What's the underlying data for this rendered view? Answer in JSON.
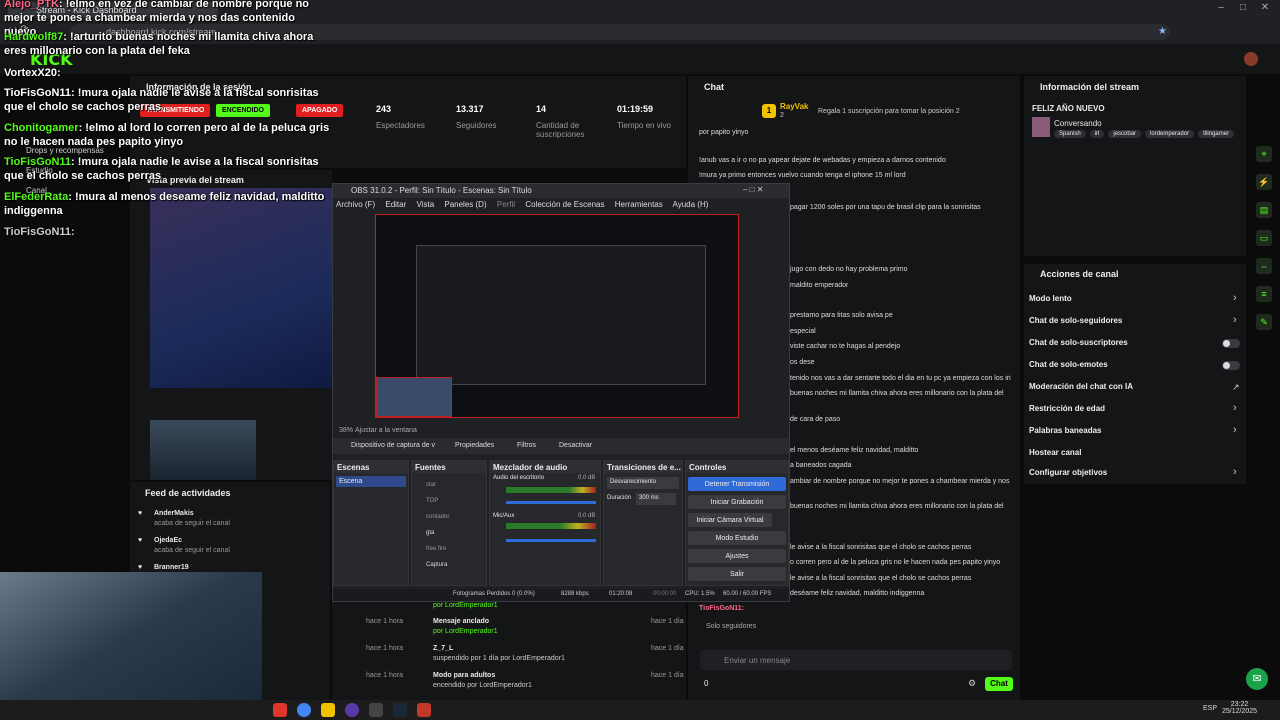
{
  "browser": {
    "tab_title": "Stream - Kick Dashboard",
    "url": "dashboard.kick.com/stream"
  },
  "kick": {
    "logo": "KICK"
  },
  "session": {
    "title": "Información de la sesión",
    "badges": [
      "TRANSMITIENDO",
      "ENCENDIDO",
      "APAGADO"
    ],
    "stats": [
      {
        "value": "243",
        "label": "Espectadores"
      },
      {
        "value": "13.317",
        "label": "Seguidores"
      },
      {
        "value": "14",
        "label": "Cantidad de suscripciones"
      },
      {
        "value": "01:19:59",
        "label": "Tiempo en vivo"
      }
    ],
    "left_menu": [
      "Drops y recompensas",
      "Canal",
      "Estudio"
    ],
    "preview_title": "Vista previa del stream"
  },
  "overlay_chat": [
    {
      "user": "Alejo_PTK",
      "msg": "!elmo en vez de cambiar de nombre porque no mejor te pones a chambear mierda y nos das contenido nuevo"
    },
    {
      "user": "Hardwolf87",
      "msg": "!arturito buenas noches mi llamita chiva ahora eres millonario con la plata del feka"
    },
    {
      "user": "VortexX20",
      "msg": ""
    },
    {
      "user": "TioFisGoN11",
      "msg": "!mura ojala nadie le avise a la fiscal sonrisitas que el cholo se cachos perras"
    },
    {
      "user": "Chonitogamer",
      "msg": "!elmo al lord lo corren pero al de la peluca gris no le hacen nada pes papito yinyo"
    },
    {
      "user": "TioFisGoN11",
      "msg": "!mura ojala nadie le avise a la fiscal sonrisitas que el cholo se cachos perras"
    },
    {
      "user": "ElFederRata",
      "msg": "!mura al menos deseame feliz navidad, malditto indiggenna"
    },
    {
      "user": "TioFisGoN11",
      "msg": ""
    }
  ],
  "obs": {
    "title": "OBS 31.0.2 - Perfil: Sin Título - Escenas: Sin Título",
    "menu": [
      "Archivo (F)",
      "Editar",
      "Vista",
      "Paneles (D)",
      "Perfil",
      "Colección de Escenas",
      "Herramientas",
      "Ayuda (H)"
    ],
    "zoom": "38%",
    "fit_label": "Ajustar a la ventana",
    "source_bar": {
      "source": "Dispositivo de captura de v",
      "props": "Propiedades",
      "filters": "Filtros",
      "deactivate": "Desactivar"
    },
    "docks": {
      "scenes": {
        "title": "Escenas",
        "items": [
          "Escena"
        ]
      },
      "sources": {
        "title": "Fuentes",
        "items": [
          "star",
          "TOP",
          "contador",
          "gta",
          "free fire",
          "Captura"
        ]
      },
      "mixer": {
        "title": "Mezclador de audio",
        "channels": [
          {
            "name": "Audio del escritorio",
            "db": "0.0 dB"
          },
          {
            "name": "Mic/Aux",
            "db": "0.0 dB"
          }
        ]
      },
      "transitions": {
        "title": "Transiciones de e...",
        "type": "Desvanecimiento",
        "duration_label": "Duración",
        "duration": "300 ms"
      },
      "controls": {
        "title": "Controles",
        "buttons": [
          "Detener Transmisión",
          "Iniciar Grabación",
          "Iniciar Cámara Virtual",
          "Modo Estudio",
          "Ajustes",
          "Salir"
        ]
      }
    },
    "status": {
      "dropped": "Fotogramas Perdidos 0 (0.0%)",
      "bitrate": "8288 kbps",
      "live": "01:20:08",
      "rec": "00:00:00",
      "cpu": "CPU: 1.5%",
      "fps": "60.00 / 60.00 FPS"
    }
  },
  "chat": {
    "title": "Chat",
    "top_user": "RayVak",
    "top_rank": "1",
    "top_count": "2",
    "sub_prompt": "Regala 1 suscripción para tomar la posición 2",
    "lines": [
      "por papito yinyo",
      "!anub vas a ir o no pa yapear dejate de webadas y empieza a darnos contenido",
      "!mura ya primo entonces vuelvo cuando tenga el iphone 15 ml lord",
      "pagar 1200 soles por una tapu de brasil clip para la sonrisitas",
      "jugo con dedo no hay problema primo",
      "maldito emperador",
      "prestamo para titas solo avisa pe",
      "especial",
      "viste cachar no te hagas al pendejo",
      "os dese",
      "tenido nos vas a dar sentarte todo el dia en tu pc ya empieza con los iri",
      "buenas noches mi llamita chiva ahora eres millonario con la plata del",
      "de cara de paso",
      "el menos deséame feliz navidad, malditto",
      "a baneados cagada",
      "ambiar de nombre porque no mejor te pones a chambear mierda y nos",
      "buenas noches mi llamita chiva ahora eres millonario con la plata del",
      "le avise a la fiscal sonrisitas que el cholo se cachos perras",
      "o corren pero al de la peluca gris no le hacen nada pes papito yinyo",
      "le avise a la fiscal sonrisitas que el cholo se cachos perras",
      "deséame feliz navidad, malditto indiggenna"
    ],
    "last_user": "TioFisGoN11:",
    "mode": "Solo seguidores",
    "input_placeholder": "Enviar un mensaje",
    "send": "Chat",
    "count": "0"
  },
  "feed": {
    "title": "Feed de actividades",
    "items": [
      {
        "user": "AnderMakis",
        "action": "acaba de seguir el canal"
      },
      {
        "user": "OjedaEc",
        "action": "acaba de seguir el canal"
      },
      {
        "user": "Branner19",
        "action": ""
      }
    ],
    "events": [
      {
        "title": "Mensaje anclado",
        "by": "por LordEmperador1",
        "time": "hace 1 hora",
        "time2": "hace 1 día"
      },
      {
        "title": "Z_7_L",
        "by": "suspendido por 1 día por LordEmperador1",
        "time": "hace 1 hora",
        "time2": "hace 1 día"
      },
      {
        "title": "Modo para adultos",
        "by": "encendido por LordEmperador1",
        "time": "hace 1 hora",
        "time2": "hace 1 día"
      }
    ],
    "top_by": "por LordEmperador1",
    "top_time": "hace 1 hora"
  },
  "stream_info": {
    "title": "Información del stream",
    "stream_name": "FELIZ AÑO NUEVO",
    "category": "Conversando",
    "tags": [
      "Spanish",
      "irl",
      "jescobar",
      "lordemperador",
      "tilingamer"
    ]
  },
  "actions": {
    "title": "Acciones de canal",
    "items": [
      {
        "label": "Modo lento",
        "kind": "chevron"
      },
      {
        "label": "Chat de solo-seguidores",
        "kind": "chevron"
      },
      {
        "label": "Chat de solo-suscriptores",
        "kind": "toggle"
      },
      {
        "label": "Chat de solo-emotes",
        "kind": "toggle"
      },
      {
        "label": "Moderación del chat con IA",
        "kind": "link"
      },
      {
        "label": "Restricción de edad",
        "kind": "chevron"
      },
      {
        "label": "Palabras baneadas",
        "kind": "chevron"
      },
      {
        "label": "Hostear canal",
        "kind": "none"
      },
      {
        "label": "Configurar objetivos",
        "kind": "chevron"
      }
    ]
  },
  "taskbar": {
    "lang": "ESP",
    "time": "23:22",
    "date": "25/12/2025"
  },
  "colors": {
    "accent": "#53fc18",
    "red": "#e02020",
    "bg": "#141517"
  }
}
